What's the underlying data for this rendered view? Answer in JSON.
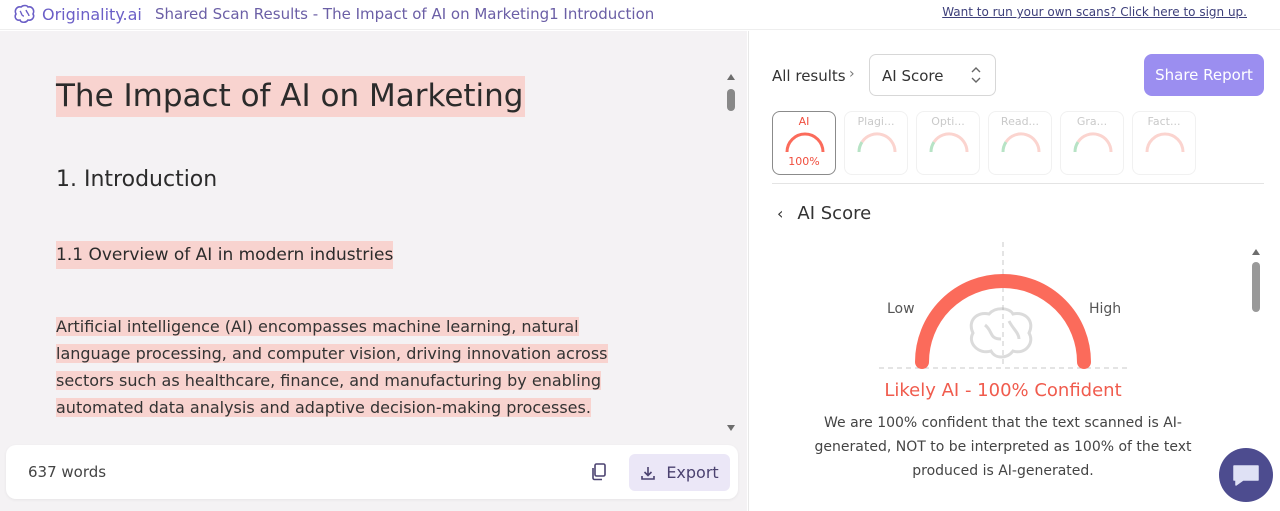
{
  "header": {
    "brand": "Originality.ai",
    "scan_title": "Shared Scan Results - The Impact of AI on Marketing1 Introduction",
    "signup_link": "Want to run your own scans? Click here to sign up."
  },
  "document": {
    "title": "The Impact of AI on Marketing",
    "h2": "1. Introduction",
    "h3": "1.1 Overview of AI in modern industries",
    "paragraph_lines": [
      "Artificial intelligence (AI) encompasses machine learning, natural",
      "language processing, and computer vision, driving innovation across",
      "sectors such as healthcare, finance, and manufacturing by enabling",
      "automated data analysis and adaptive decision-making processes."
    ],
    "highlight_color": "#f8d3cf"
  },
  "footer": {
    "word_count": "637 words",
    "export_label": "Export"
  },
  "results": {
    "all_results_label": "All results",
    "selected_score": "AI Score",
    "share_label": "Share Report",
    "tabs": [
      {
        "label": "AI",
        "value": "100%",
        "active": true
      },
      {
        "label": "Plagi...",
        "value": "",
        "active": false
      },
      {
        "label": "Opti...",
        "value": "",
        "active": false
      },
      {
        "label": "Read...",
        "value": "",
        "active": false
      },
      {
        "label": "Gra...",
        "value": "",
        "active": false
      },
      {
        "label": "Fact...",
        "value": "",
        "active": false
      }
    ],
    "section_title": "AI Score",
    "low_label": "Low",
    "high_label": "High",
    "score": 100,
    "verdict": "Likely AI - 100% Confident",
    "explanation": "We are 100% confident that the text scanned is AI-generated, NOT to be interpreted as 100% of the text produced is AI-generated."
  },
  "colors": {
    "accent": "#9b8ef0",
    "gauge": "#fb6b5b",
    "verdict": "#f05b4d",
    "brand": "#6b5fc7"
  },
  "icons": {
    "brand": "brain-icon",
    "copy": "copy-icon",
    "export": "download-icon",
    "chat": "chat-icon"
  }
}
